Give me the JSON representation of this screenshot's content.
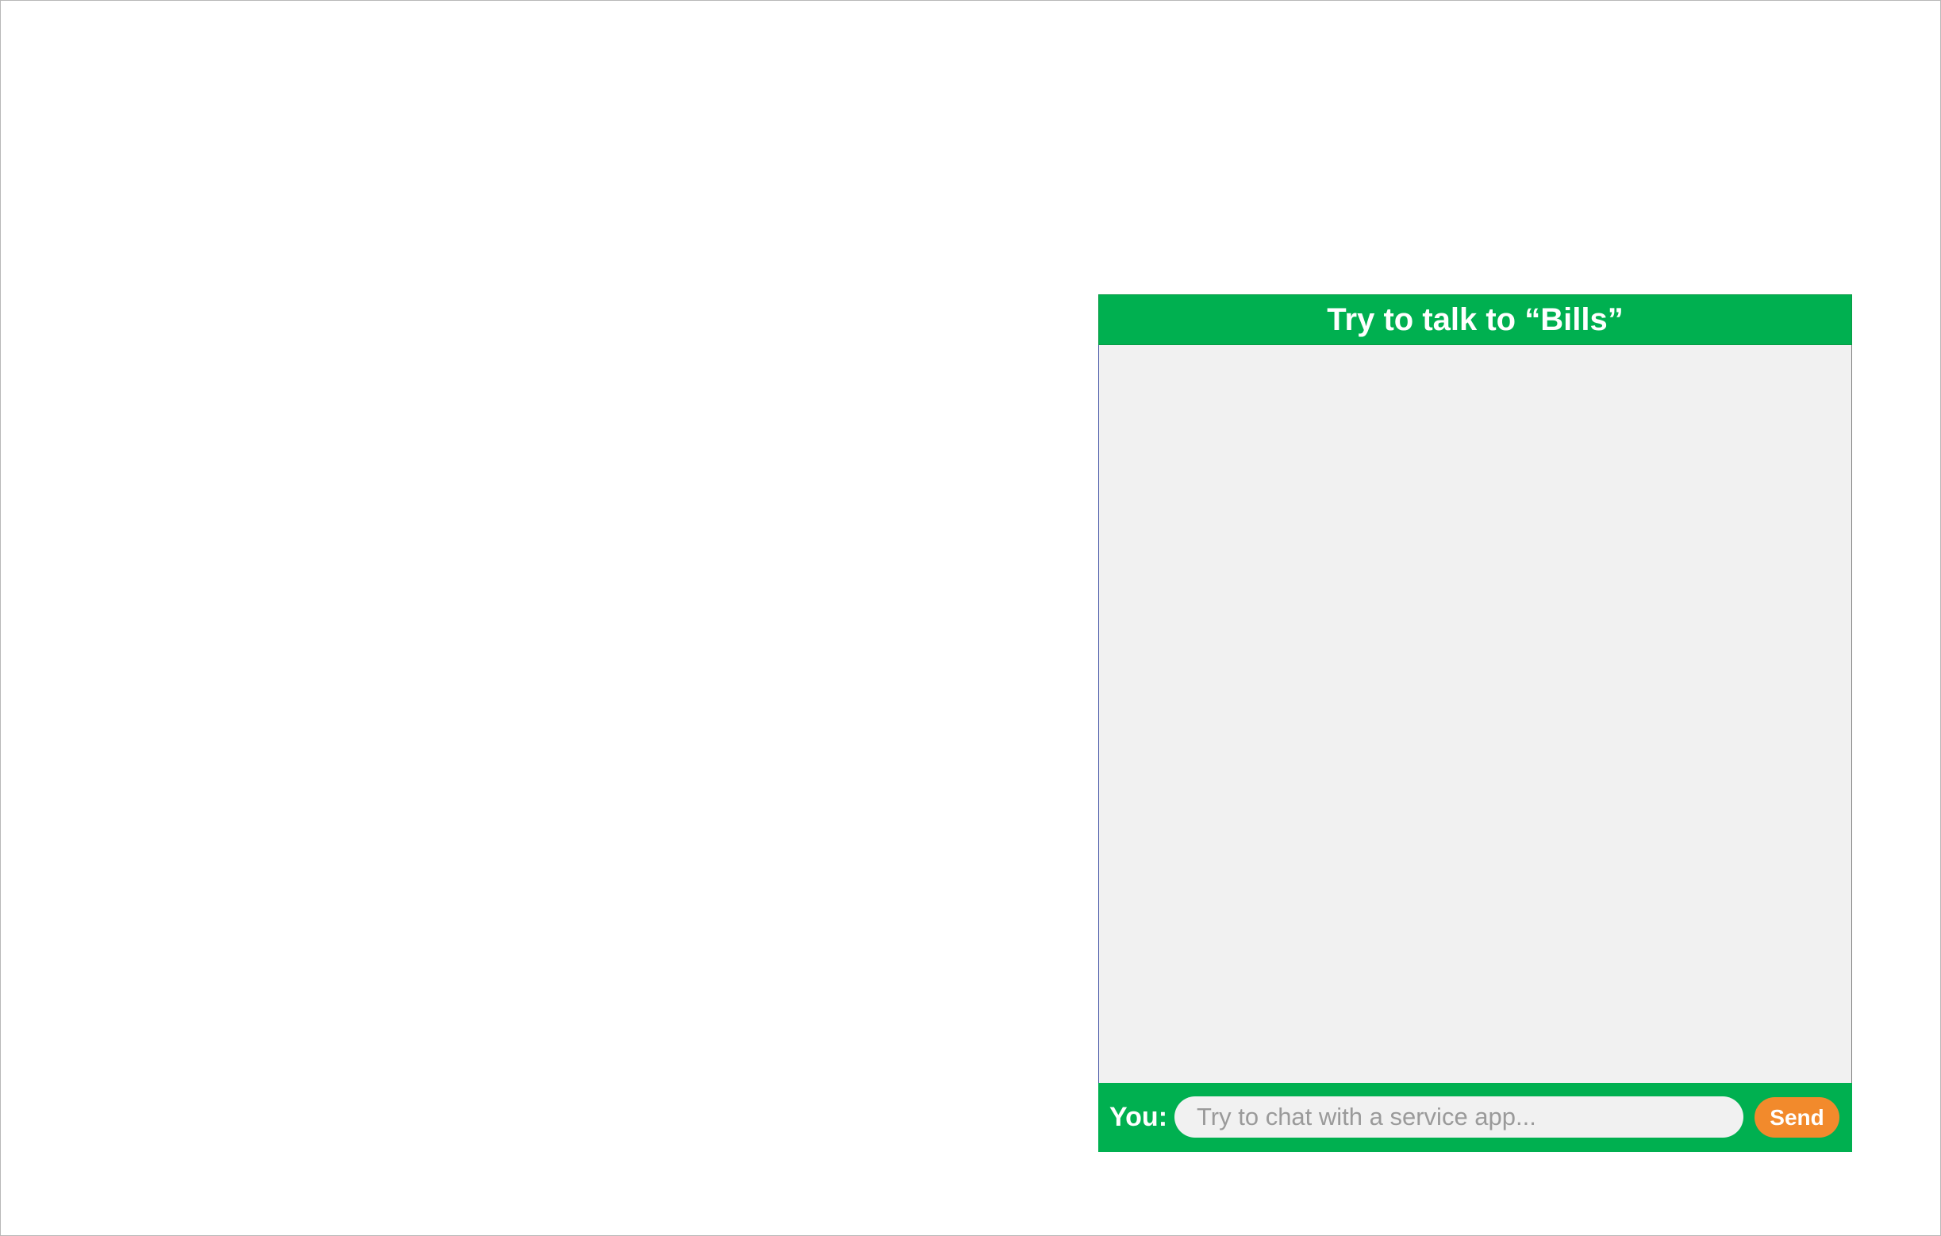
{
  "chat": {
    "title": "Try to talk to “Bills”",
    "messages": [],
    "composer": {
      "you_label": "You:",
      "input_value": "",
      "input_placeholder": "Try to chat with a service app...",
      "send_label": "Send"
    }
  },
  "colors": {
    "header_bg": "#00b050",
    "body_bg": "#f1f1f1",
    "send_button_bg": "#f28a2c",
    "text_light": "#ffffff",
    "placeholder": "#9a9a9a"
  }
}
